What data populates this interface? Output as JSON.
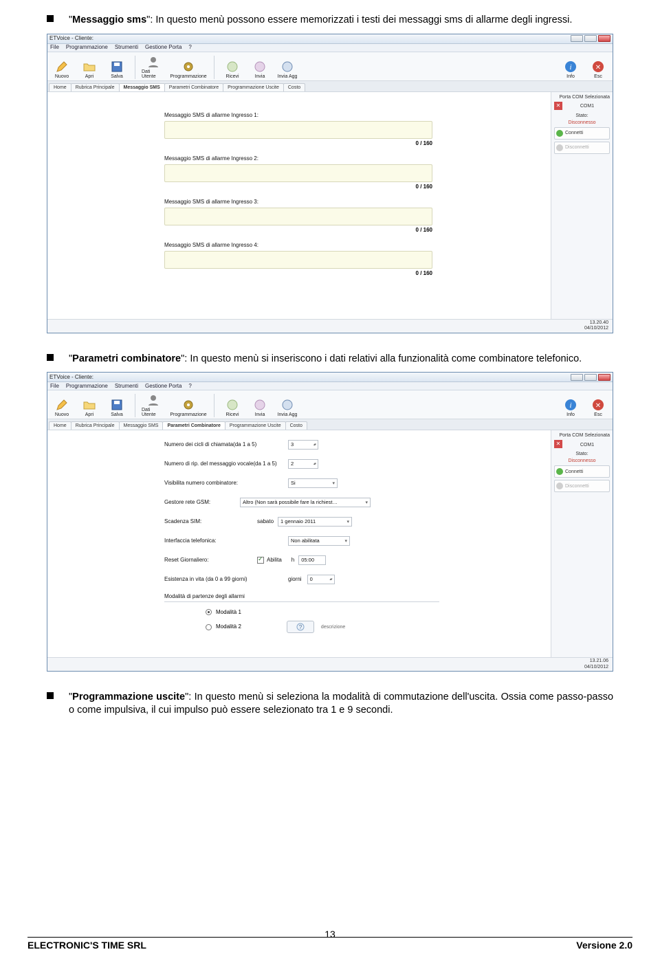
{
  "doc": {
    "bullet1": {
      "title": "Messaggio sms",
      "text": ": In questo menù possono essere memorizzati i testi dei messaggi sms di allarme degli ingressi."
    },
    "bullet2": {
      "title": "Parametri combinatore",
      "text": ": In questo menù si inseriscono i dati relativi alla funzionalità come combinatore telefonico."
    },
    "bullet3": {
      "title": "Programmazione uscite",
      "text": ": In questo menù si seleziona la modalità di commutazione dell'uscita. Ossia come passo-passo o come impulsiva, il cui impulso può essere selezionato tra 1 e 9 secondi."
    }
  },
  "app": {
    "title": "ETVoice - Cliente:",
    "menubar": [
      "File",
      "Programmazione",
      "Strumenti",
      "Gestione Porta",
      "?"
    ],
    "toolbar": {
      "nuovo": "Nuovo",
      "apri": "Apri",
      "salva": "Salva",
      "dati_utente": "Dati Utente",
      "programmazione": "Programmazione",
      "ricevi": "Ricevi",
      "invia": "Invia",
      "invia_agg": "Invia Agg",
      "info": "Info",
      "esc": "Esc"
    },
    "tabs": {
      "home": "Home",
      "rubrica": "Rubrica Principale",
      "messaggio_sms": "Messaggio SMS",
      "parametri": "Parametri Combinatore",
      "prog_uscite": "Programmazione Uscite",
      "costo": "Costo"
    },
    "side": {
      "porta_label": "Porta COM Selezionata",
      "porta_value": "COM1",
      "stato_label": "Stato:",
      "stato_value": "Disconnesso",
      "connetti": "Connetti",
      "disconnetti": "Disconnetti"
    },
    "status1": {
      "time": "13.20.40",
      "date": "04/10/2012"
    },
    "status2": {
      "time": "13.21.06",
      "date": "04/10/2012"
    }
  },
  "sms_screen": {
    "labels": [
      "Messaggio SMS di allarme Ingresso 1:",
      "Messaggio SMS di allarme Ingresso 2:",
      "Messaggio SMS di allarme Ingresso 3:",
      "Messaggio SMS di allarme Ingresso 4:"
    ],
    "counter": "0   / 160"
  },
  "param_screen": {
    "rows": {
      "cicli": {
        "label": "Numero dei cicli di chiamata(da 1 a 5)",
        "value": "3"
      },
      "rip": {
        "label": "Numero di rip. del messaggio vocale(da 1 a 5)",
        "value": "2"
      },
      "visibilita": {
        "label": "Visibilita numero combinatore:",
        "value": "Si"
      },
      "gestore": {
        "label": "Gestore rete GSM:",
        "value": "Altro (Non sarà possibile fare la richiest…"
      },
      "scadenza": {
        "label": "Scadenza SIM:",
        "day": "sabato",
        "date": "1  gennaio  2011"
      },
      "interfaccia": {
        "label": "Interfaccia telefonica:",
        "value": "Non abilitata"
      },
      "reset": {
        "label": "Reset Giornaliero:",
        "abilita": "Abilita",
        "h": "h",
        "time": "05:00"
      },
      "esistenza": {
        "label": "Esistenza in vita (da 0 a 99 giorni)",
        "unit": "giorni",
        "value": "0"
      }
    },
    "section": "Modalità di partenze degli allarmi",
    "mod1": "Modalità 1",
    "mod2": "Modalità 2",
    "desc": "descrizione"
  },
  "footer": {
    "company": "ELECTRONIC'S TIME SRL",
    "page": "13",
    "version": "Versione 2.0"
  }
}
